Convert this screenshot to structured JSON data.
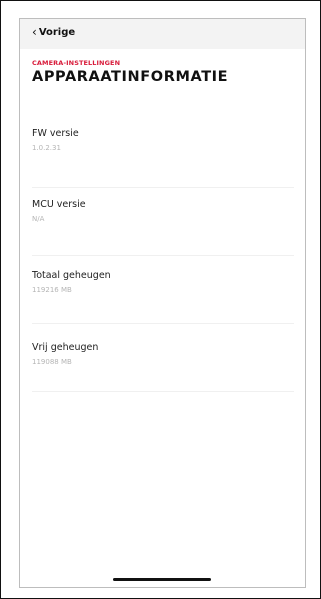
{
  "nav": {
    "back_label": "Vorige",
    "back_icon": "chevron-left-icon"
  },
  "header": {
    "section": "CAMERA-INSTELLINGEN",
    "title": "APPARAATINFORMATIE",
    "section_color": "#d81b3a"
  },
  "info": [
    {
      "label": "FW versie",
      "value": "1.0.2.31"
    },
    {
      "label": "MCU versie",
      "value": "N/A"
    },
    {
      "label": "Totaal geheugen",
      "value": "119216 MB"
    },
    {
      "label": "Vrij geheugen",
      "value": "119088 MB"
    }
  ]
}
